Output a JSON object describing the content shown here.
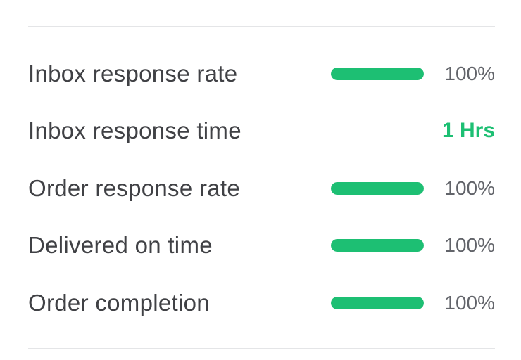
{
  "seller_stats": {
    "accent_color": "#1dbf73",
    "rows": [
      {
        "label": "Inbox response rate",
        "type": "progress",
        "percent": 100,
        "value": "100%"
      },
      {
        "label": "Inbox response time",
        "type": "text",
        "value": "1 Hrs"
      },
      {
        "label": "Order response rate",
        "type": "progress",
        "percent": 100,
        "value": "100%"
      },
      {
        "label": "Delivered on time",
        "type": "progress",
        "percent": 100,
        "value": "100%"
      },
      {
        "label": "Order completion",
        "type": "progress",
        "percent": 100,
        "value": "100%"
      }
    ]
  }
}
